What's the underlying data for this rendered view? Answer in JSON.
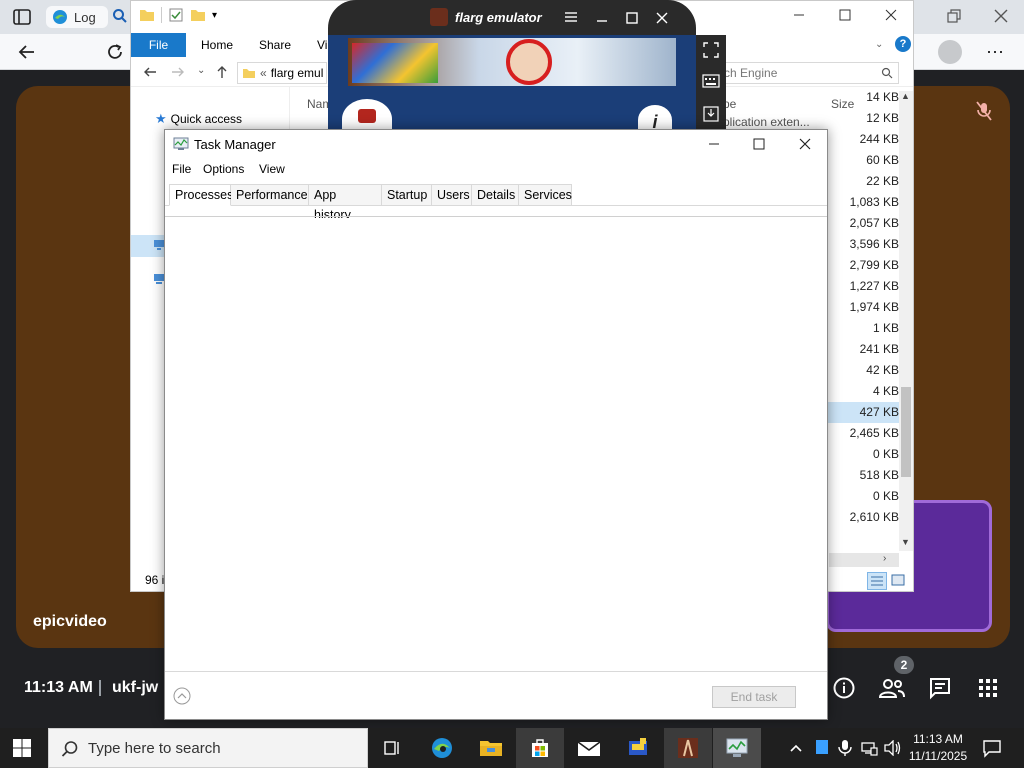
{
  "browser": {
    "tab_title": "Log",
    "icons": [
      "sidebar-icon",
      "edge-icon",
      "search-icon",
      "restore-icon",
      "close-icon",
      "back-icon",
      "refresh-icon",
      "more-icon"
    ]
  },
  "call": {
    "tile_label": "epicvideo",
    "time": "11:13 AM",
    "code": "ukf-jw",
    "participants_count": "2"
  },
  "explorer": {
    "tabs": [
      "File",
      "Home",
      "Share",
      "Vi"
    ],
    "address": "flarg emul",
    "search_placeholder": "rch Engine",
    "column_name": "Nam",
    "column_type": "pe",
    "column_size": "Size",
    "type_value": "plication exten...",
    "quick_access": "Quick access",
    "item_count": "96 i",
    "sizes": [
      "14 KB",
      "12 KB",
      "244 KB",
      "60 KB",
      "22 KB",
      "1,083 KB",
      "2,057 KB",
      "3,596 KB",
      "2,799 KB",
      "1,227 KB",
      "1,974 KB",
      "1 KB",
      "241 KB",
      "42 KB",
      "4 KB",
      "427 KB",
      "2,465 KB",
      "0 KB",
      "518 KB",
      "0 KB",
      "2,610 KB"
    ],
    "selected_index": 15
  },
  "emulator": {
    "title": "flarg emulator"
  },
  "taskmgr": {
    "title": "Task Manager",
    "menu": [
      "File",
      "Options",
      "View"
    ],
    "tabs": [
      "Processes",
      "Performance",
      "App history",
      "Startup",
      "Users",
      "Details",
      "Services"
    ],
    "end_task": "End task"
  },
  "taskbar": {
    "search_placeholder": "Type here to search",
    "time": "11:13 AM",
    "date": "11/11/2025"
  },
  "colors": {
    "video_tile": "#5a3511",
    "accent_blue": "#1979ca",
    "taskbar": "#1f1f1f"
  }
}
